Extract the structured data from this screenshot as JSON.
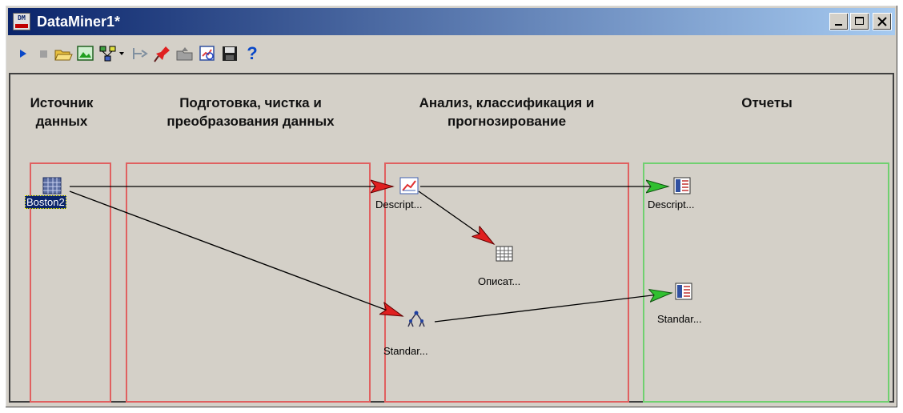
{
  "window": {
    "title": "DataMiner1*",
    "app_icon_text": "DM"
  },
  "toolbar": {
    "buttons": [
      "run-icon",
      "stop-icon",
      "open-folder-icon",
      "image-icon",
      "network-icon",
      "step-icon",
      "pin-icon",
      "folder-up-icon",
      "report-icon",
      "save-icon",
      "help-icon"
    ],
    "help_label": "?"
  },
  "columns": [
    {
      "line1": "Источник",
      "line2": "данных"
    },
    {
      "line1": "Подготовка, чистка и",
      "line2": "преобразования данных"
    },
    {
      "line1": "Анализ, классификация и",
      "line2": "прогнозирование"
    },
    {
      "line1": "Отчеты",
      "line2": ""
    }
  ],
  "nodes": {
    "source": {
      "label": "Boston2",
      "icon": "table-icon"
    },
    "descript_analysis": {
      "label": "Descript...",
      "icon": "chart-icon"
    },
    "opisat": {
      "label": "Описат...",
      "icon": "grid-icon"
    },
    "standar_analysis": {
      "label": "Standar...",
      "icon": "tree-icon"
    },
    "descript_report": {
      "label": "Descript...",
      "icon": "report-icon"
    },
    "standar_report": {
      "label": "Standar...",
      "icon": "report-icon"
    }
  },
  "colors": {
    "zone_red": "#e06060",
    "zone_green": "#70d070",
    "arrow_red": "#e02020",
    "arrow_green": "#30c030"
  }
}
